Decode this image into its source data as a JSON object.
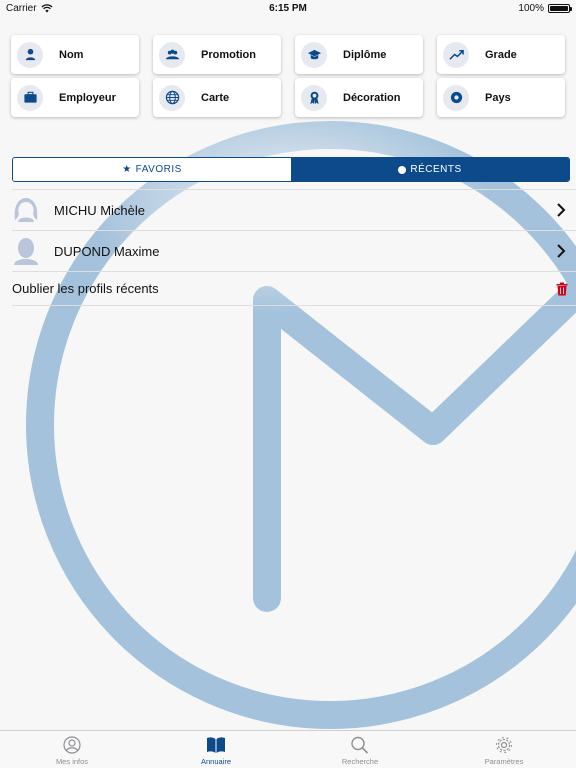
{
  "status_bar": {
    "carrier": "Carrier",
    "time": "6:15 PM",
    "battery": "100%",
    "battery_level": 1.0
  },
  "shortcuts": [
    {
      "label": "Nom",
      "icon": "person-icon"
    },
    {
      "label": "Promotion",
      "icon": "group-icon"
    },
    {
      "label": "Diplôme",
      "icon": "graduation-cap-icon"
    },
    {
      "label": "Grade",
      "icon": "trend-up-icon"
    },
    {
      "label": "Employeur",
      "icon": "briefcase-icon"
    },
    {
      "label": "Carte",
      "icon": "globe-icon"
    },
    {
      "label": "Décoration",
      "icon": "medal-icon"
    },
    {
      "label": "Pays",
      "icon": "flag-circle-icon"
    }
  ],
  "segments": {
    "favoris": "FAVORIS",
    "recents": "RÉCENTS",
    "selected": "recents"
  },
  "recent_profiles": [
    {
      "name": "MICHU Michèle"
    },
    {
      "name": "DUPOND Maxime"
    }
  ],
  "forget_label": "Oublier les profils récents",
  "tabs": [
    {
      "label": "Mes infos",
      "icon": "profile-circle-icon",
      "active": false
    },
    {
      "label": "Annuaire",
      "icon": "book-icon",
      "active": true
    },
    {
      "label": "Recherche",
      "icon": "search-icon",
      "active": false
    },
    {
      "label": "Paramètres",
      "icon": "gear-icon",
      "active": false
    }
  ],
  "colors": {
    "accent": "#0d4a8c",
    "logo": "#a4c2dc",
    "trash": "#d0021b"
  }
}
